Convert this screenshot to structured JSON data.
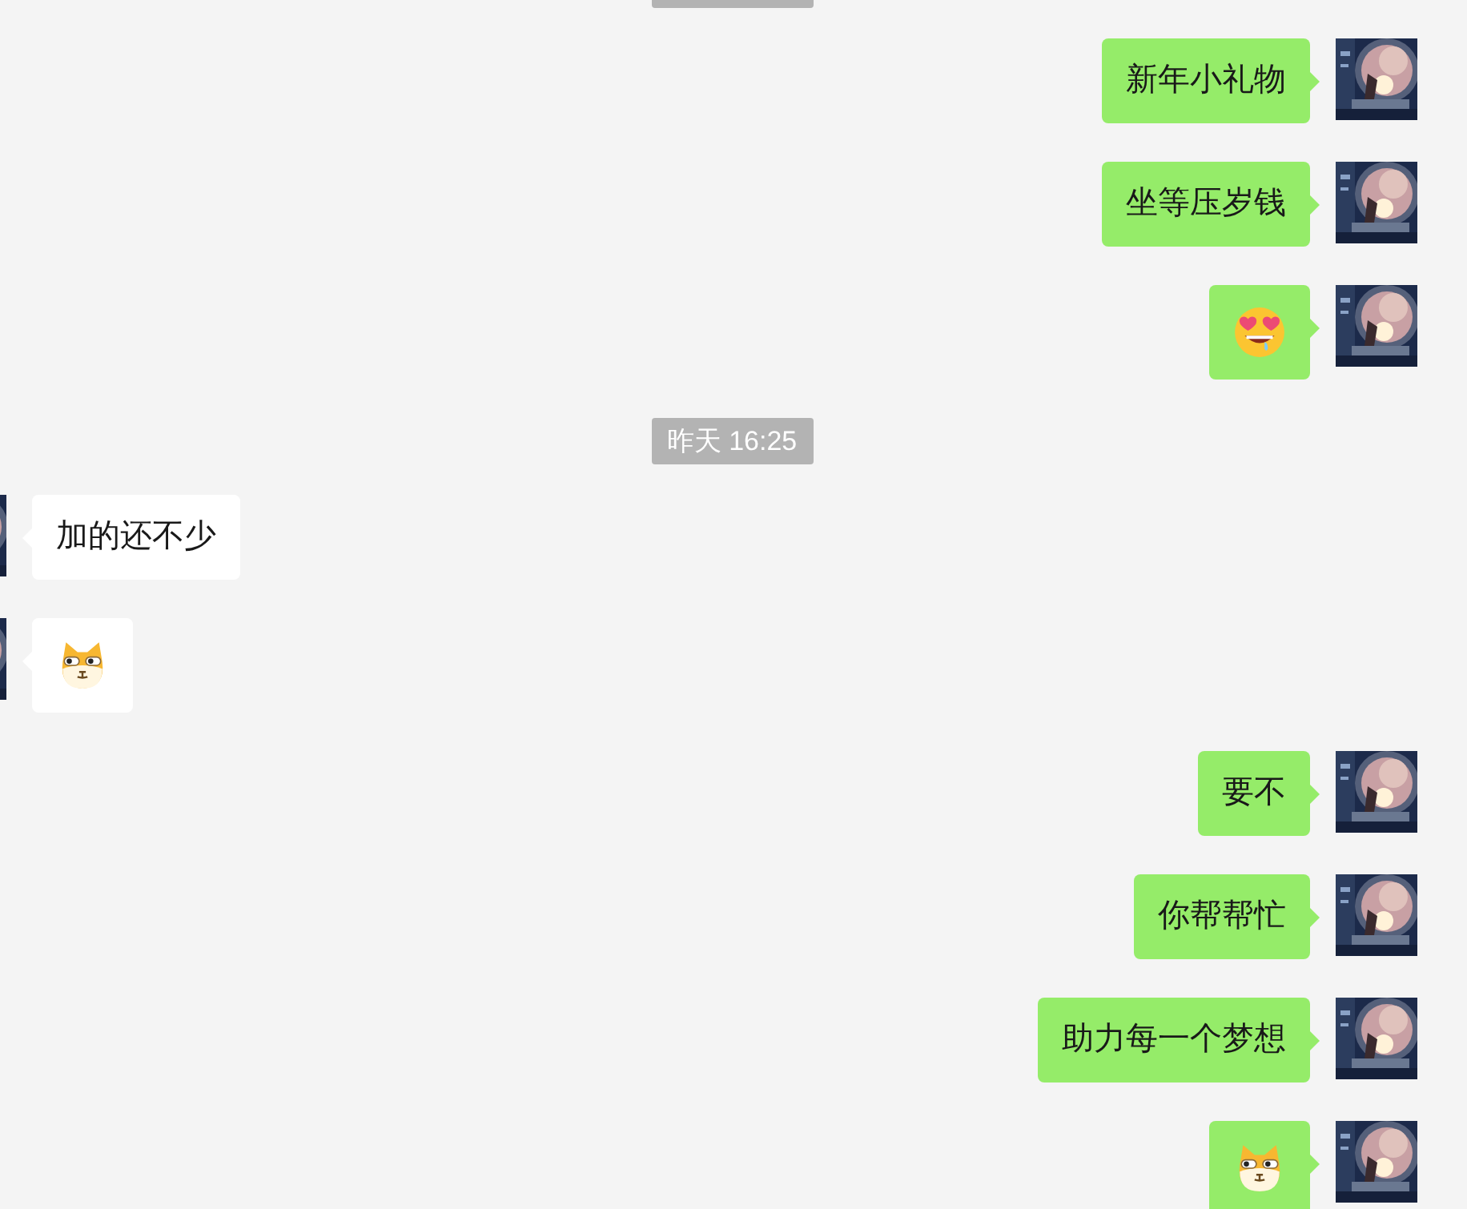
{
  "messages": [
    {
      "kind": "time_cut"
    },
    {
      "kind": "text",
      "mine": true,
      "text": "新年小礼物"
    },
    {
      "kind": "text",
      "mine": true,
      "text": "坐等压岁钱"
    },
    {
      "kind": "love_emoji",
      "mine": true
    },
    {
      "kind": "time",
      "text": "昨天 16:25"
    },
    {
      "kind": "text",
      "mine": false,
      "text": "加的还不少"
    },
    {
      "kind": "cat_emoji",
      "mine": false
    },
    {
      "kind": "text",
      "mine": true,
      "text": "要不"
    },
    {
      "kind": "text",
      "mine": true,
      "text": "你帮帮忙"
    },
    {
      "kind": "text",
      "mine": true,
      "text": "助力每一个梦想"
    },
    {
      "kind": "cat_emoji",
      "mine": true
    }
  ]
}
